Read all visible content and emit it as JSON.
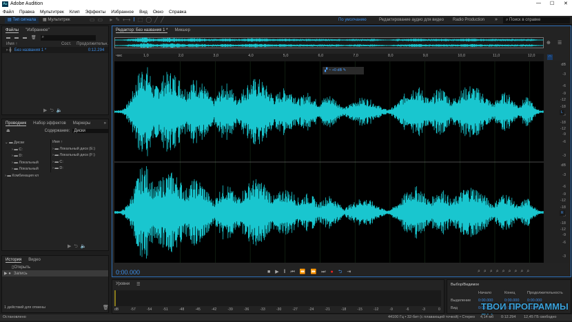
{
  "app": {
    "title": "Adobe Audition",
    "logo": "Au"
  },
  "menu": [
    "Файл",
    "Правка",
    "Мультитрек",
    "Клип",
    "Эффекты",
    "Избранное",
    "Вид",
    "Окно",
    "Справка"
  ],
  "toolbar": {
    "waveform": "Тип сигнала",
    "multitrack": "Мультитрек"
  },
  "workspaces": {
    "active": "По умолчанию",
    "items": [
      "Редактирование аудио для видео",
      "Radio Production"
    ],
    "more": "»",
    "search_placeholder": "Поиск в справке"
  },
  "files_panel": {
    "tabs": [
      "Файлы",
      "\"Избранное\""
    ],
    "columns": [
      "Имя ↑",
      "Сост.",
      "Продолжительн."
    ],
    "rows": [
      {
        "name": "Без названия 1 *",
        "duration": "0:12.294"
      }
    ]
  },
  "explorer": {
    "tabs": [
      "Проводник",
      "Набор эффектов",
      "Маркеры"
    ],
    "content_label": "Содержание:",
    "content_value": "Диски",
    "tree": [
      "Диски",
      "C:",
      "D:",
      "Локальный",
      "Локальный",
      "Комбинация кл"
    ],
    "column": "Имя ↑",
    "list": [
      "Локальный диск (E:)",
      "Локальный диск (F:)",
      "C:",
      "D:"
    ]
  },
  "history": {
    "tabs": [
      "История",
      "Видео"
    ],
    "items": [
      "Открыть",
      "Запись"
    ],
    "footer": "1 действий для отмены"
  },
  "status": {
    "left": "Остановлено",
    "format": "44100 Гц • 32-бит (с плавающей точкой) • Стерео",
    "size": "4,14 мб",
    "duration": "0:12.294",
    "free": "12,45 ГБ свободно"
  },
  "editor": {
    "tabs": [
      "Редактор: Без названия 1 *",
      "Микшер"
    ],
    "ruler_unit": "чмс",
    "ruler": [
      "1,0",
      "2,0",
      "3,0",
      "4,0",
      "5,0",
      "6,0",
      "7,0",
      "8,0",
      "9,0",
      "10,0",
      "11,0",
      "12,0"
    ],
    "hud_gain": "+0 dB",
    "time": "0:00.000",
    "db_scale": [
      "dB",
      "-3",
      "-6",
      "-9",
      "-12",
      "-18",
      "-∞",
      "-18",
      "-12",
      "-9",
      "-6",
      "-3"
    ],
    "channels": [
      "L",
      "R"
    ],
    "waveform_color": "#19c6cf"
  },
  "levels": {
    "title": "Уровни",
    "scale": [
      "dB",
      "-57",
      "-54",
      "-51",
      "-48",
      "-45",
      "-42",
      "-39",
      "-36",
      "-33",
      "-30",
      "-27",
      "-24",
      "-21",
      "-18",
      "-15",
      "-12",
      "-9",
      "-6",
      "-3",
      "0"
    ]
  },
  "selection": {
    "title": "Выбор/Видимое",
    "columns": [
      "Начало",
      "Конец",
      "Продолжительность"
    ],
    "rows": [
      {
        "label": "Выделение",
        "values": [
          "0:00.000",
          "0:00.000",
          "0:00.000"
        ]
      },
      {
        "label": "Вид",
        "values": [
          "0:00.000",
          "0:12.294",
          "0:12.294"
        ]
      }
    ]
  },
  "watermark": "ТВОИ ПРОГРАММЫ РУ"
}
